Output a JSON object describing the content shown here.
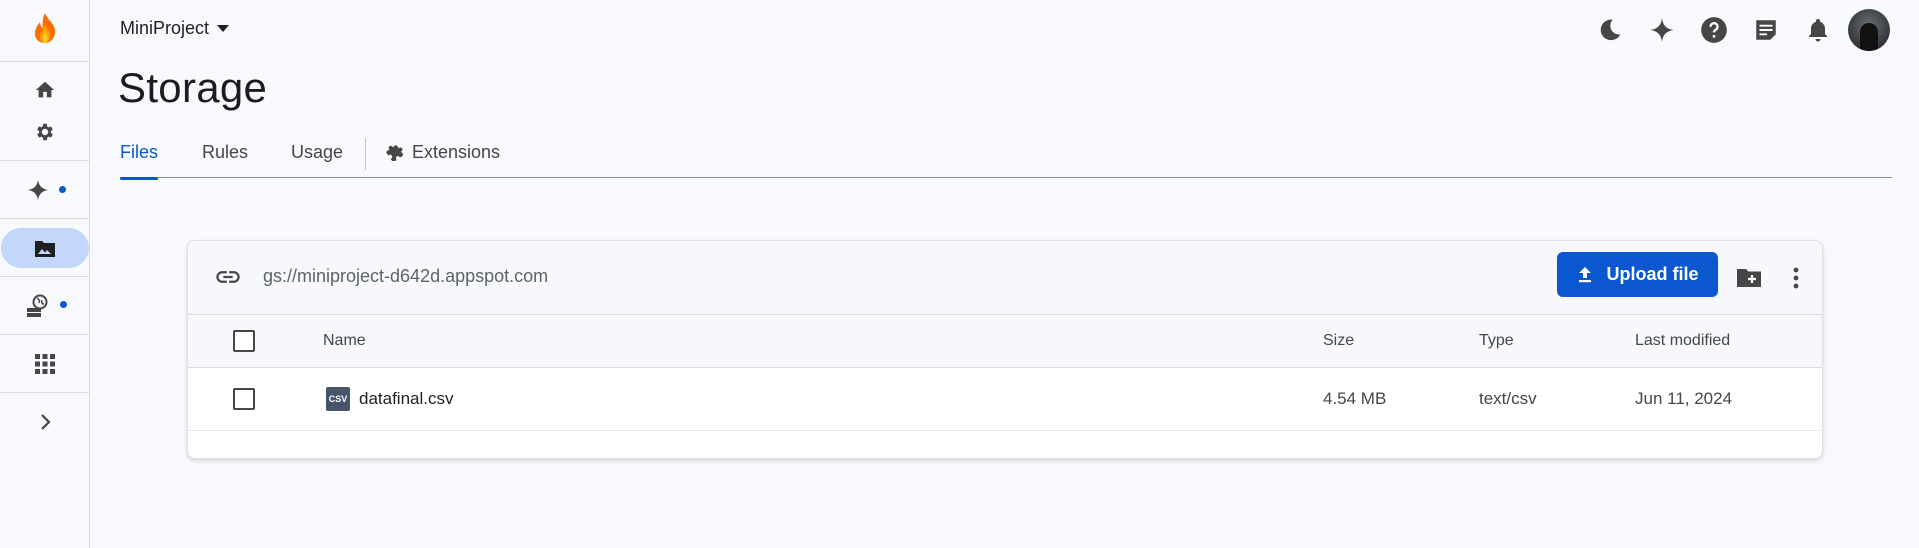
{
  "header": {
    "project_name": "MiniProject",
    "page_title": "Storage"
  },
  "tabs": [
    {
      "label": "Files",
      "active": true
    },
    {
      "label": "Rules",
      "active": false
    },
    {
      "label": "Usage",
      "active": false
    },
    {
      "label": "Extensions",
      "active": false
    }
  ],
  "sidebar": {
    "items": [
      {
        "icon": "home-icon"
      },
      {
        "icon": "gear-icon"
      },
      {
        "icon": "sparkle-icon"
      },
      {
        "icon": "storage-icon",
        "active": true
      },
      {
        "icon": "hosting-icon"
      },
      {
        "icon": "apps-grid-icon"
      },
      {
        "icon": "chevron-right-icon"
      }
    ]
  },
  "storage": {
    "bucket_path": "gs://miniproject-d642d.appspot.com",
    "upload_label": "Upload file",
    "columns": {
      "name": "Name",
      "size": "Size",
      "type": "Type",
      "modified": "Last modified"
    },
    "rows": [
      {
        "name": "datafinal.csv",
        "file_badge": "CSV",
        "size": "4.54 MB",
        "type": "text/csv",
        "modified": "Jun 11, 2024"
      }
    ]
  },
  "colors": {
    "accent": "#0b57d0",
    "active_pill": "#c2d7fb",
    "background": "#f8f9fd"
  }
}
